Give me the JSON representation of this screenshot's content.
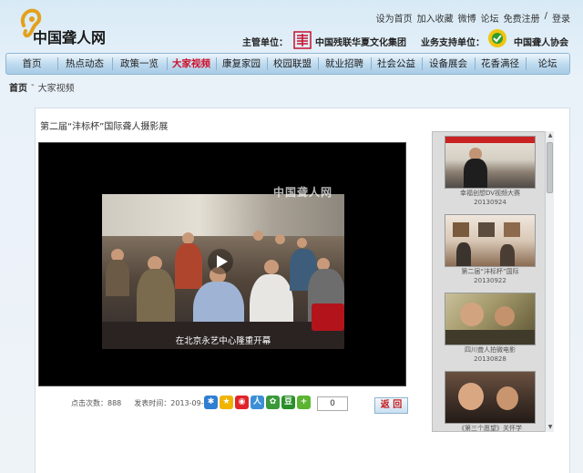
{
  "header": {
    "logo_text": "中国聋人网",
    "top_links": [
      "设为首页",
      "加入收藏",
      "微博",
      "论坛",
      "免费注册",
      "/",
      "登录"
    ],
    "sponsor_label": "主管单位：",
    "sponsor_org": "中国残联华夏文化集团",
    "support_label": "业务支持单位：",
    "support_org": "中国聋人协会"
  },
  "nav": {
    "items": [
      "首页",
      "热点动态",
      "政策一览",
      "大家视频",
      "康复家园",
      "校园联盟",
      "就业招聘",
      "社会公益",
      "设备展会",
      "花香满径",
      "论坛"
    ],
    "active": "大家视频"
  },
  "breadcrumb": {
    "home": "首页",
    "sep": "-",
    "current": "大家视频"
  },
  "video": {
    "title": "第二届“沣标杯”国际聋人摄影展",
    "watermark": "中国聋人网",
    "subtitle": "在北京永艺中心隆重开幕",
    "views_label": "点击次数：",
    "views": "888",
    "date_label": "发表时间：",
    "date": "2013-09-22",
    "like_count": "0",
    "back_label": "返 回"
  },
  "share_icons": [
    "qzone-icon",
    "favorite-icon",
    "weibo-icon",
    "renren-icon",
    "kaixin-icon",
    "douban-icon",
    "more-share-icon"
  ],
  "colors": {
    "accent": "#d0102a",
    "nav_bg": "#bcd9ee",
    "page_bg": "#e3eff8"
  },
  "related": [
    {
      "title": "幸福创想DV视频大赛",
      "date": "20130924"
    },
    {
      "title": "第二届“沣标杯”国际",
      "date": "20130922"
    },
    {
      "title": "四川聋人拍微电影",
      "date": "20130828"
    },
    {
      "title": "《第三个愿望》关怀学",
      "date": ""
    }
  ]
}
